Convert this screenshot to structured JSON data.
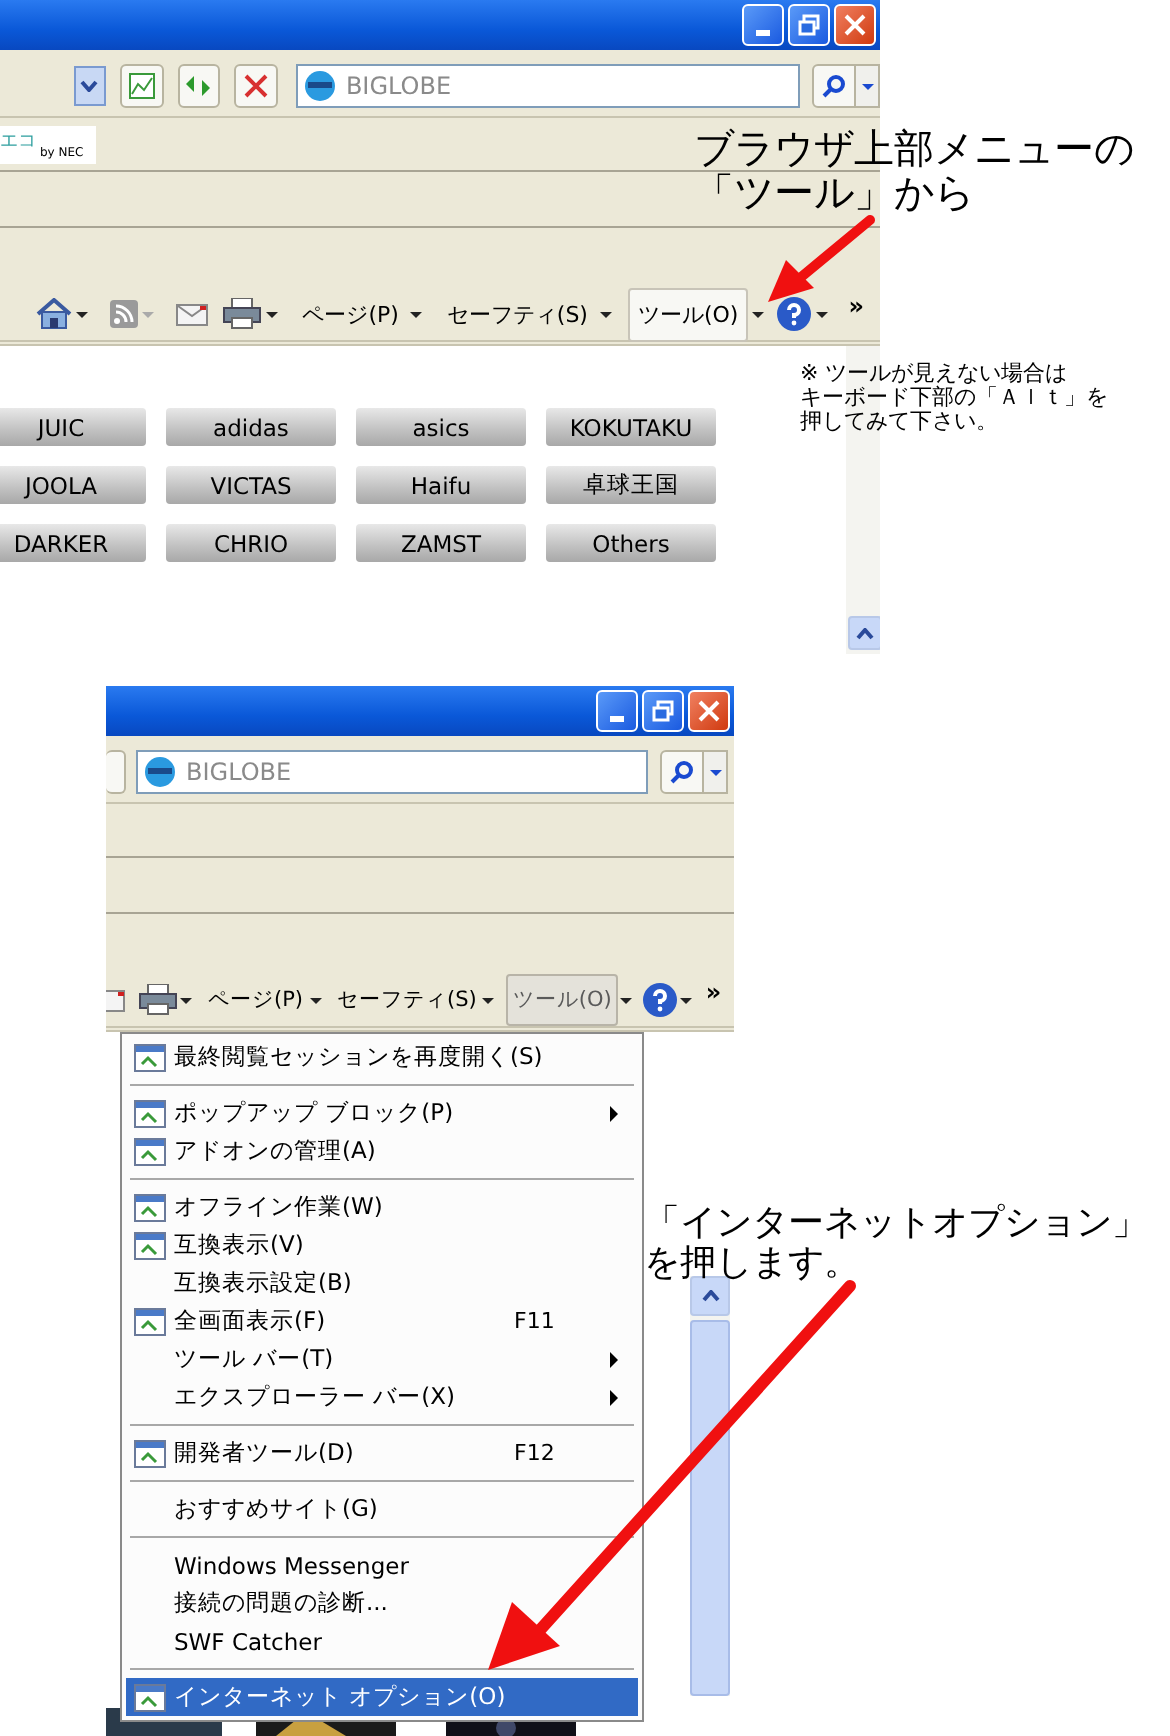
{
  "top_screenshot": {
    "search": {
      "value": "BIGLOBE"
    },
    "banner": {
      "text": "エコ",
      "byline": "by NEC"
    },
    "toolbar": {
      "commands": [
        {
          "label": "ページ(P)",
          "highlighted": false
        },
        {
          "label": "セーフティ(S)",
          "highlighted": false
        },
        {
          "label": "ツール(O)",
          "highlighted": true
        }
      ],
      "overflow": "»"
    },
    "brand_buttons": [
      "JUIC",
      "adidas",
      "asics",
      "KOKUTAKU",
      "JOOLA",
      "VICTAS",
      "Haifu",
      "卓球王国",
      "DARKER",
      "CHRIO",
      "ZAMST",
      "Others"
    ]
  },
  "top_annotation": {
    "lines": [
      "ブラウザ上部メニューの",
      "「ツール」から"
    ]
  },
  "note": {
    "lines": [
      "※ ツールが見えない場合は",
      "キーボード下部の「Ａｌｔ」を",
      "押してみて下さい。"
    ]
  },
  "bottom_screenshot": {
    "search": {
      "value": "BIGLOBE"
    },
    "toolbar": {
      "commands": [
        {
          "label": "ページ(P)",
          "highlighted": false
        },
        {
          "label": "セーフティ(S)",
          "highlighted": false
        },
        {
          "label": "ツール(O)",
          "highlighted": true
        }
      ],
      "overflow": "»"
    },
    "menu": [
      {
        "kind": "item",
        "label": "最終閲覧セッションを再度開く(S)",
        "icon": true,
        "submenu": false,
        "selected": false
      },
      {
        "kind": "separator"
      },
      {
        "kind": "item",
        "label": "ポップアップ ブロック(P)",
        "icon": true,
        "submenu": true,
        "selected": false
      },
      {
        "kind": "item",
        "label": "アドオンの管理(A)",
        "icon": true,
        "submenu": false,
        "selected": false
      },
      {
        "kind": "separator"
      },
      {
        "kind": "item",
        "label": "オフライン作業(W)",
        "icon": true,
        "submenu": false,
        "selected": false
      },
      {
        "kind": "item",
        "label": "互換表示(V)",
        "icon": true,
        "submenu": false,
        "selected": false
      },
      {
        "kind": "item",
        "label": "互換表示設定(B)",
        "icon": false,
        "submenu": false,
        "selected": false
      },
      {
        "kind": "item",
        "label": "全画面表示(F)",
        "icon": true,
        "shortcut": "F11",
        "submenu": false,
        "selected": false
      },
      {
        "kind": "item",
        "label": "ツール バー(T)",
        "icon": false,
        "submenu": true,
        "selected": false
      },
      {
        "kind": "item",
        "label": "エクスプローラー バー(X)",
        "icon": false,
        "submenu": true,
        "selected": false
      },
      {
        "kind": "separator"
      },
      {
        "kind": "item",
        "label": "開発者ツール(D)",
        "icon": true,
        "shortcut": "F12",
        "submenu": false,
        "selected": false
      },
      {
        "kind": "separator"
      },
      {
        "kind": "item",
        "label": "おすすめサイト(G)",
        "icon": false,
        "submenu": false,
        "selected": false
      },
      {
        "kind": "separator"
      },
      {
        "kind": "item",
        "label": "Windows Messenger",
        "icon": false,
        "submenu": false,
        "selected": false
      },
      {
        "kind": "item",
        "label": "接続の問題の診断...",
        "icon": false,
        "submenu": false,
        "selected": false
      },
      {
        "kind": "item",
        "label": "SWF Catcher",
        "icon": false,
        "submenu": false,
        "selected": false
      },
      {
        "kind": "separator"
      },
      {
        "kind": "item",
        "label": "インターネット オプション(O)",
        "icon": true,
        "submenu": false,
        "selected": true
      }
    ]
  },
  "bottom_annotation": {
    "lines": [
      "「インターネットオプション」",
      "を押します。"
    ]
  }
}
